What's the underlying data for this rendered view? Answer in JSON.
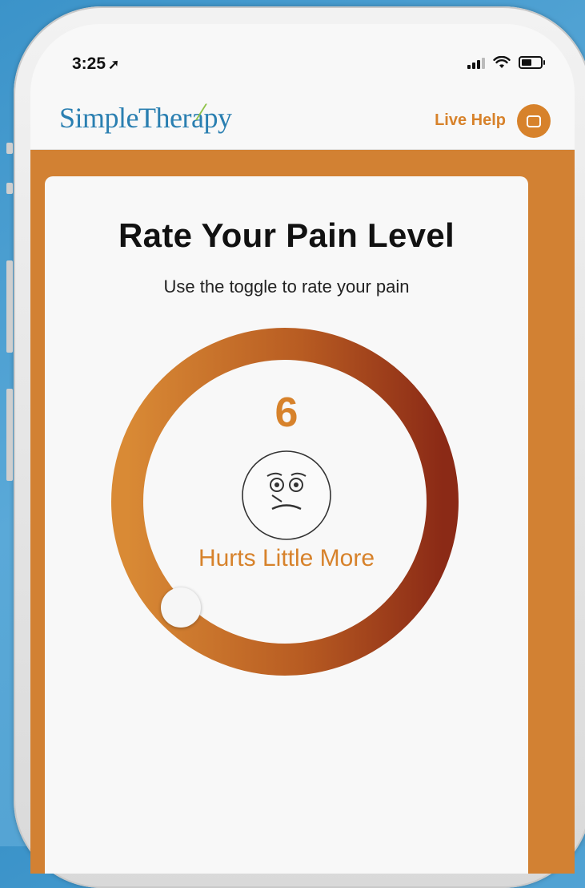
{
  "status_bar": {
    "time": "3:25",
    "location_icon": "location-arrow-icon"
  },
  "app_bar": {
    "logo_text": "SimpleTherapy",
    "live_help_label": "Live Help",
    "chat_icon": "chat-bubble-icon"
  },
  "pain_rating": {
    "title": "Rate Your Pain Level",
    "subtitle": "Use the toggle to rate your pain",
    "value": "6",
    "value_label": "Hurts Little More",
    "face_icon": "pain-face-icon",
    "dial_gradient": [
      "#d98a35",
      "#b85c22",
      "#8b2a16"
    ],
    "knob_fraction": 0.55
  },
  "colors": {
    "accent": "#d7822b",
    "logo_blue": "#2a7fb1",
    "logo_green": "#8fc349",
    "frame_orange": "#d28133"
  }
}
